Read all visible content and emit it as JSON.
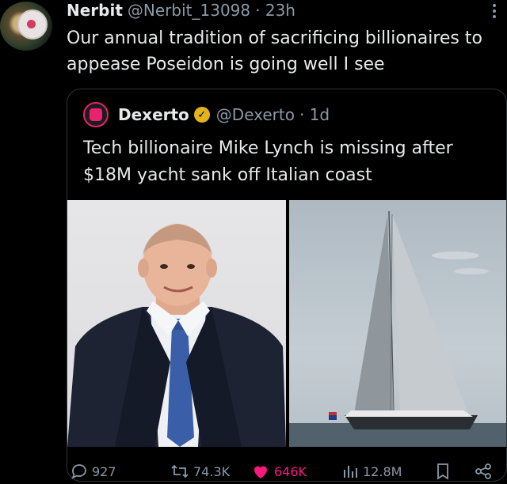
{
  "post": {
    "author_name": "Nerbit",
    "author_handle": "@Nerbit_13098",
    "time": "· 23h",
    "text": "Our annual tradition of sacrificing billionaires to appease Poseidon is going well I see"
  },
  "quote": {
    "author_name": "Dexerto",
    "author_handle": "@Dexerto",
    "time": "· 1d",
    "text": "Tech billionaire Mike Lynch is missing after $18M yacht sank off Italian coast"
  },
  "stats": {
    "replies": "927",
    "reposts": "74.3K",
    "likes": "646K",
    "views": "12.8M"
  },
  "colors": {
    "like": "#f91880",
    "verified_badge": "#e2b31c",
    "muted": "#8b98a5"
  }
}
